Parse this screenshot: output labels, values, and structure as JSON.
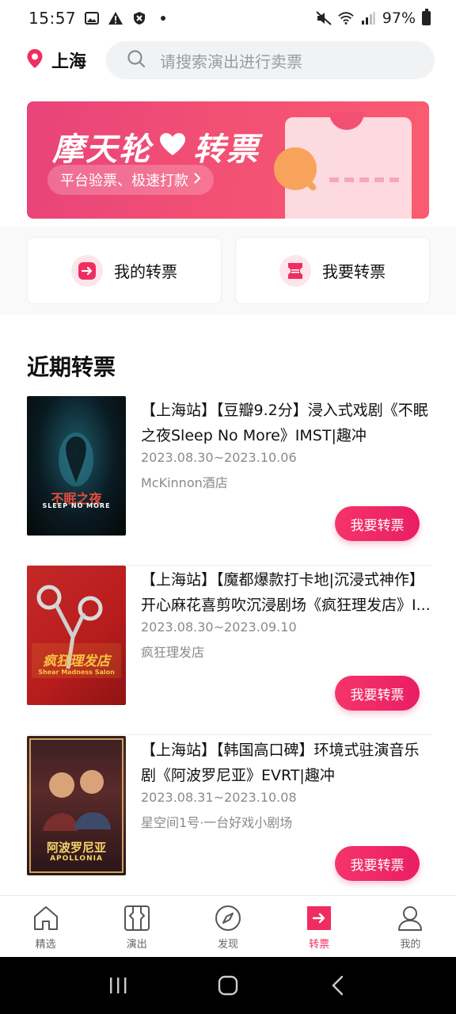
{
  "status_bar": {
    "time": "15:57",
    "battery": "97%"
  },
  "header": {
    "city": "上海",
    "search_placeholder": "请搜索演出进行卖票"
  },
  "banner": {
    "title_left": "摩天轮",
    "title_right": "转票",
    "subtitle": "平台验票、极速打款",
    "accent": "#f24f74"
  },
  "actions": {
    "my_tickets": "我的转票",
    "sell_ticket": "我要转票"
  },
  "section": {
    "title": "近期转票"
  },
  "items": [
    {
      "title": "【上海站】【豆瓣9.2分】浸入式戏剧《不眠之夜Sleep No More》IMST|趣冲",
      "date": "2023.08.30~2023.10.06",
      "venue": "McKinnon酒店",
      "button": "我要转票",
      "poster_text": "不眠之夜",
      "poster_sub": "SLEEP NO MORE"
    },
    {
      "title": "【上海站】【魔都爆款打卡地|沉浸式神作】开心麻花喜剪吹沉浸剧场《疯狂理发店》I...",
      "date": "2023.08.30~2023.09.10",
      "venue": "疯狂理发店",
      "button": "我要转票",
      "poster_text": "疯狂理发店",
      "poster_sub": "Shear Madness Salon"
    },
    {
      "title": "【上海站】【韩国高口碑】环境式驻演音乐剧《阿波罗尼亚》EVRT|趣冲",
      "date": "2023.08.31~2023.10.08",
      "venue": "星空间1号·一台好戏小剧场",
      "button": "我要转票",
      "poster_text": "阿波罗尼亚",
      "poster_sub": "APOLLONIA"
    }
  ],
  "bottom_nav": [
    {
      "label": "精选",
      "icon": "home-icon",
      "active": false
    },
    {
      "label": "演出",
      "icon": "ticket-frame-icon",
      "active": false
    },
    {
      "label": "发现",
      "icon": "compass-icon",
      "active": false
    },
    {
      "label": "转票",
      "icon": "transfer-ticket-icon",
      "active": true
    },
    {
      "label": "我的",
      "icon": "profile-icon",
      "active": false
    }
  ],
  "colors": {
    "accent": "#ef2d61",
    "button": "#e91e63"
  }
}
